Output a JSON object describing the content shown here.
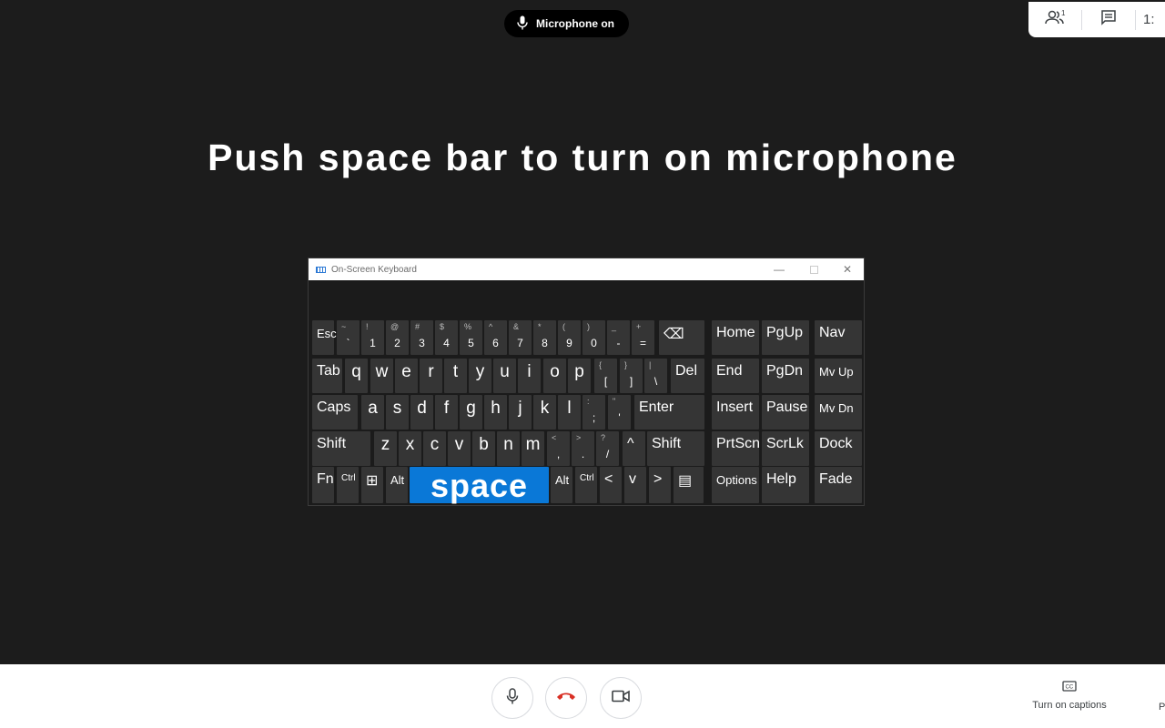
{
  "colors": {
    "stage_bg": "#1c1c1c",
    "space_key": "#0a78d7",
    "hangup_red": "#d93025"
  },
  "top": {
    "mic_status": "Microphone on",
    "people_badge": "1",
    "clock_partial": "1:"
  },
  "headline": "Push space bar to turn on microphone",
  "osk": {
    "title": "On-Screen Keyboard",
    "rows": [
      [
        {
          "id": "esc",
          "label": "Esc",
          "small": true
        },
        {
          "id": "backtick",
          "sub": "~",
          "main": "`"
        },
        {
          "id": "1",
          "sub": "!",
          "main": "1"
        },
        {
          "id": "2",
          "sub": "@",
          "main": "2"
        },
        {
          "id": "3",
          "sub": "#",
          "main": "3"
        },
        {
          "id": "4",
          "sub": "$",
          "main": "4"
        },
        {
          "id": "5",
          "sub": "%",
          "main": "5"
        },
        {
          "id": "6",
          "sub": "^",
          "main": "6"
        },
        {
          "id": "7",
          "sub": "&",
          "main": "7"
        },
        {
          "id": "8",
          "sub": "*",
          "main": "8"
        },
        {
          "id": "9",
          "sub": "(",
          "main": "9"
        },
        {
          "id": "0",
          "sub": ")",
          "main": "0"
        },
        {
          "id": "minus",
          "sub": "_",
          "main": "-"
        },
        {
          "id": "equals",
          "sub": "+",
          "main": "="
        },
        {
          "id": "backspace",
          "label": "⌫"
        },
        {
          "id": "home",
          "label": "Home"
        },
        {
          "id": "pgup",
          "label": "PgUp"
        },
        {
          "id": "nav",
          "label": "Nav"
        }
      ],
      [
        {
          "id": "tab",
          "label": "Tab"
        },
        {
          "id": "q",
          "letter": "q"
        },
        {
          "id": "w",
          "letter": "w"
        },
        {
          "id": "e",
          "letter": "e"
        },
        {
          "id": "r",
          "letter": "r"
        },
        {
          "id": "t",
          "letter": "t"
        },
        {
          "id": "y",
          "letter": "y"
        },
        {
          "id": "u",
          "letter": "u"
        },
        {
          "id": "i",
          "letter": "i"
        },
        {
          "id": "o",
          "letter": "o"
        },
        {
          "id": "p",
          "letter": "p"
        },
        {
          "id": "lbracket",
          "sub": "{",
          "main": "["
        },
        {
          "id": "rbracket",
          "sub": "}",
          "main": "]"
        },
        {
          "id": "backslash",
          "sub": "|",
          "main": "\\"
        },
        {
          "id": "del",
          "label": "Del"
        },
        {
          "id": "end",
          "label": "End"
        },
        {
          "id": "pgdn",
          "label": "PgDn"
        },
        {
          "id": "mvup",
          "label": "Mv Up",
          "small": true
        }
      ],
      [
        {
          "id": "caps",
          "label": "Caps"
        },
        {
          "id": "a",
          "letter": "a"
        },
        {
          "id": "s",
          "letter": "s"
        },
        {
          "id": "d",
          "letter": "d"
        },
        {
          "id": "f",
          "letter": "f"
        },
        {
          "id": "g",
          "letter": "g"
        },
        {
          "id": "h",
          "letter": "h"
        },
        {
          "id": "j",
          "letter": "j"
        },
        {
          "id": "k",
          "letter": "k"
        },
        {
          "id": "l",
          "letter": "l"
        },
        {
          "id": "semicolon",
          "sub": ":",
          "main": ";"
        },
        {
          "id": "quote",
          "sub": "\"",
          "main": "'"
        },
        {
          "id": "enter",
          "label": "Enter"
        },
        {
          "id": "insert",
          "label": "Insert"
        },
        {
          "id": "pause",
          "label": "Pause"
        },
        {
          "id": "mvdn",
          "label": "Mv Dn",
          "small": true
        }
      ],
      [
        {
          "id": "lshift",
          "label": "Shift"
        },
        {
          "id": "z",
          "letter": "z"
        },
        {
          "id": "x",
          "letter": "x"
        },
        {
          "id": "c",
          "letter": "c"
        },
        {
          "id": "v",
          "letter": "v"
        },
        {
          "id": "b",
          "letter": "b"
        },
        {
          "id": "n",
          "letter": "n"
        },
        {
          "id": "m",
          "letter": "m"
        },
        {
          "id": "comma",
          "sub": "<",
          "main": ","
        },
        {
          "id": "period",
          "sub": ">",
          "main": "."
        },
        {
          "id": "slash",
          "sub": "?",
          "main": "/"
        },
        {
          "id": "up",
          "label": "^"
        },
        {
          "id": "rshift",
          "label": "Shift"
        },
        {
          "id": "prtscn",
          "label": "PrtScn"
        },
        {
          "id": "scrlk",
          "label": "ScrLk"
        },
        {
          "id": "dock",
          "label": "Dock"
        }
      ],
      [
        {
          "id": "fn",
          "label": "Fn"
        },
        {
          "id": "lctrl",
          "label": "Ctrl",
          "tiny": true
        },
        {
          "id": "win",
          "label": "⊞"
        },
        {
          "id": "lalt",
          "label": "Alt",
          "small": true
        },
        {
          "id": "space",
          "label": "space"
        },
        {
          "id": "ralt",
          "label": "Alt",
          "small": true
        },
        {
          "id": "rctrl",
          "label": "Ctrl",
          "tiny": true
        },
        {
          "id": "left",
          "label": "<"
        },
        {
          "id": "down",
          "label": "v"
        },
        {
          "id": "right",
          "label": ">"
        },
        {
          "id": "menu",
          "label": "▤"
        },
        {
          "id": "options",
          "label": "Options",
          "small": true
        },
        {
          "id": "help",
          "label": "Help"
        },
        {
          "id": "fade",
          "label": "Fade"
        }
      ]
    ]
  },
  "bottom": {
    "captions_label": "Turn on captions",
    "edge_partial": "P"
  }
}
